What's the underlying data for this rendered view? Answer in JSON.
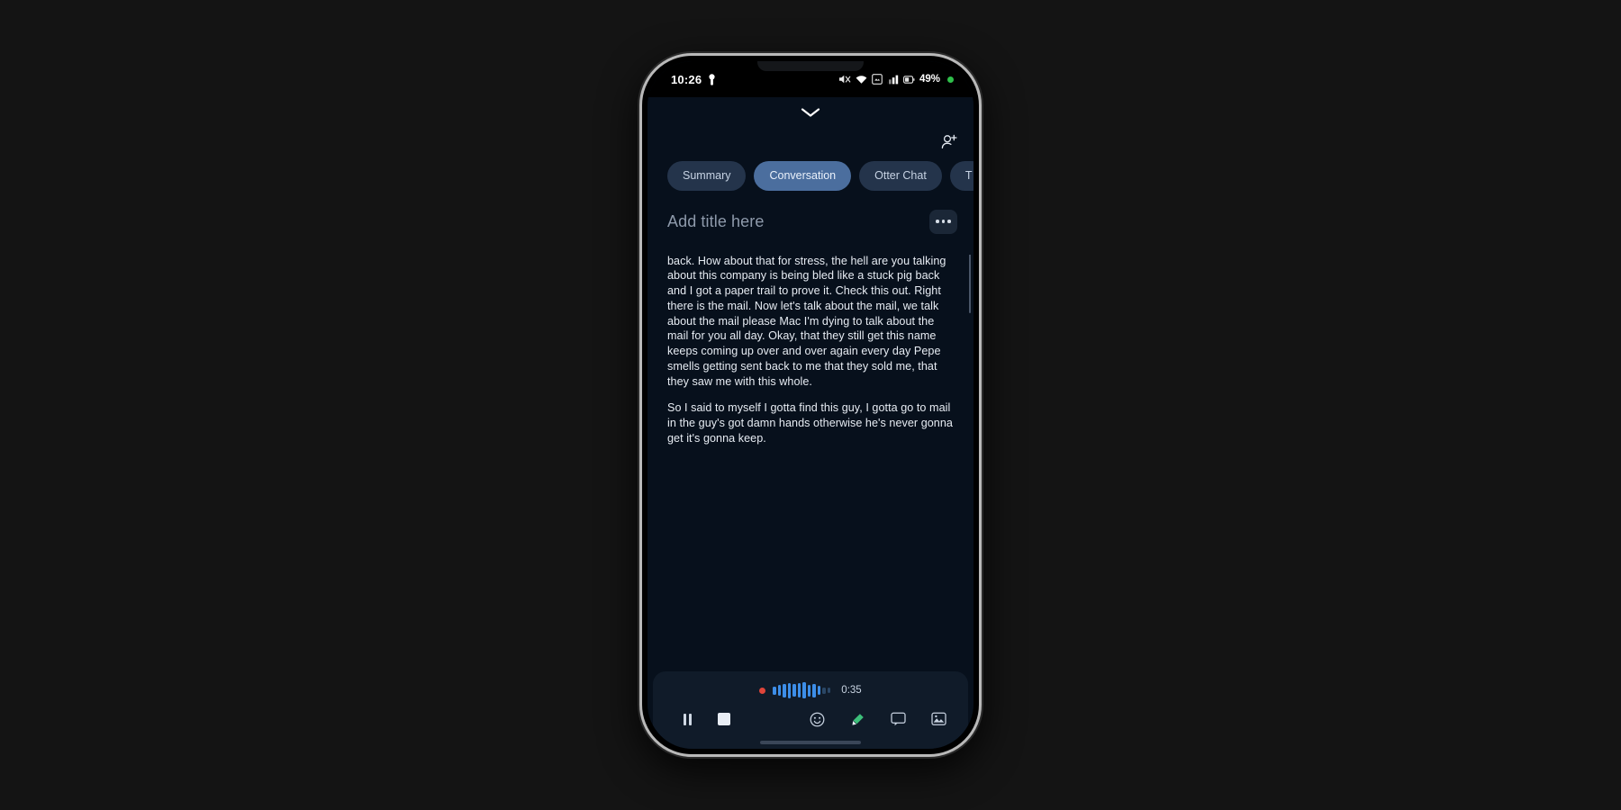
{
  "status_bar": {
    "time": "10:26",
    "battery_text": "49%",
    "icons": [
      "key-icon",
      "mute-icon",
      "wifi-icon",
      "screenshot-icon",
      "cell-signal-icon",
      "battery-icon",
      "recording-dot-icon"
    ]
  },
  "header": {
    "collapse_icon": "chevron-down-icon",
    "add_people_icon": "add-person-icon"
  },
  "tabs": [
    {
      "label": "Summary",
      "active": false
    },
    {
      "label": "Conversation",
      "active": true
    },
    {
      "label": "Otter Chat",
      "active": false
    },
    {
      "label": "T",
      "active": false
    }
  ],
  "note": {
    "title": "Add title here",
    "more_icon": "overflow-menu-icon",
    "paragraphs": [
      "their Okay, I stumbled onto a major company conspiracy back. How about that for stress, the hell are you talking about this company is being bled like a stuck pig back and I got a paper trail to prove it. Check this out. Right there is the mail. Now let's talk about the mail, we talk about the mail please Mac I'm dying to talk about the mail for you all day. Okay, that they still get this name keeps coming up over and over again every day Pepe smells getting sent back to me that they sold me, that they saw me with this whole.",
      "So I said to myself I gotta find this guy, I gotta go to mail in the guy's got damn hands otherwise he's never gonna get it's gonna keep."
    ]
  },
  "recorder": {
    "recording_indicator": "recording-dot-icon",
    "timer": "0:35",
    "waveform_levels": [
      9,
      12,
      15,
      17,
      14,
      16,
      18,
      13,
      15,
      10,
      7,
      6
    ],
    "waveform_active_count": 10,
    "pause_icon": "pause-icon",
    "stop_icon": "stop-icon",
    "actions": [
      {
        "icon": "emoji-icon"
      },
      {
        "icon": "highlight-icon"
      },
      {
        "icon": "comment-icon"
      },
      {
        "icon": "image-icon"
      }
    ]
  },
  "colors": {
    "app_background": "#07101c",
    "tab_active": "#4b6e9e",
    "tab_inactive": "#24344b",
    "accent_wave": "#3d8ee8",
    "record_red": "#e0453a",
    "status_green": "#2fbf4a"
  }
}
